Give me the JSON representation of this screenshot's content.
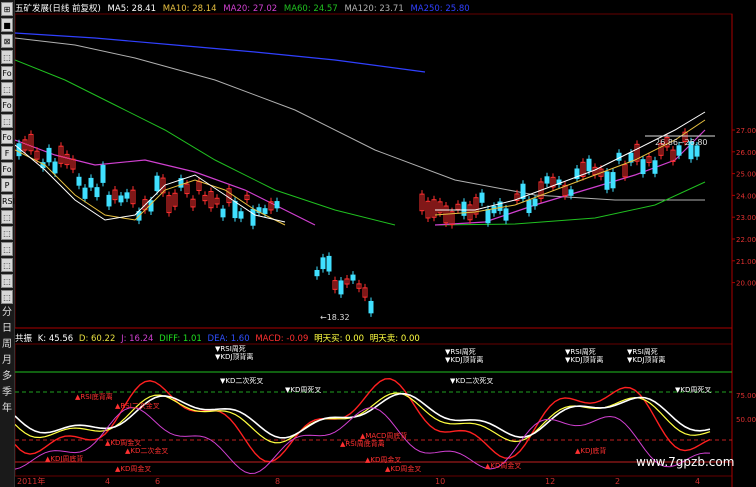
{
  "toolbar": {
    "buttons": [
      "⊞",
      "■",
      "⊠",
      "⬚",
      "Fo",
      "⬚",
      "Fo",
      "⬚",
      "Fo",
      "F",
      "Fo",
      "P",
      "RSI",
      "⬚",
      "⬚",
      "⬚",
      "⬚",
      "⬚",
      "⬚"
    ],
    "periods": [
      "分",
      "日",
      "周",
      "月",
      "多",
      "季",
      "年"
    ]
  },
  "topbar": {
    "title": "五矿发展(日线 前复权)",
    "ma5": "MA5: 28.41",
    "ma10": "MA10: 28.14",
    "ma20": "MA20: 27.02",
    "ma60": "MA60: 24.57",
    "ma120": "MA120: 23.71",
    "ma250": "MA250: 25.80"
  },
  "midbar": {
    "name": "共振",
    "k": "K: 45.56",
    "d": "D: 60.22",
    "j": "J: 16.24",
    "diff": "DIFF: 1.01",
    "dea": "DEA: 1.60",
    "macd": "MACD: -0.09",
    "buy": "明天买: 0.00",
    "sell": "明天卖: 0.00"
  },
  "colors": {
    "up": "#ff3030",
    "down": "#40e0ff",
    "ma5": "#ffffff",
    "ma10": "#e8c040",
    "ma20": "#d040d0",
    "ma60": "#20c020",
    "ma120": "#b0b0b0",
    "ma250": "#3040ff"
  },
  "watermark": "www.7gpzb.com",
  "chart_data": {
    "type": "line",
    "price_axis_ticks": [
      "27.00",
      "26.00",
      "25.00",
      "24.00",
      "23.00",
      "22.00",
      "21.00",
      "20.00"
    ],
    "osc_axis_ticks": [
      "75.00",
      "50.00"
    ],
    "annotations_price": [
      "←18.32",
      "26.86~26.80"
    ],
    "annotations_osc": [
      "▼RSI周死",
      "▼KDJ顶背离",
      "▼KD二次死叉",
      "▼KD周死叉",
      "▲RSI底背离",
      "▲RSI二次金叉",
      "▲KD周金叉",
      "▲KD二次金叉",
      "▲KD周金叉",
      "▲KDJ周底背",
      "▲RSI周底背离",
      "▲MACD周底背",
      "▲KD周金叉",
      "▲KD周金叉",
      "▼RSI周死",
      "▼KDJ顶背离",
      "▼KD二次死叉",
      "▼RSI周死",
      "▼KDJ顶背离",
      "▼RSI周死",
      "▼KDJ顶背离",
      "▼KD周死叉",
      "▲KD周金叉",
      "▲KDJ底背"
    ],
    "xlabels": [
      "2011年",
      "4",
      "6",
      "8",
      "10",
      "12",
      "2",
      "4"
    ]
  }
}
